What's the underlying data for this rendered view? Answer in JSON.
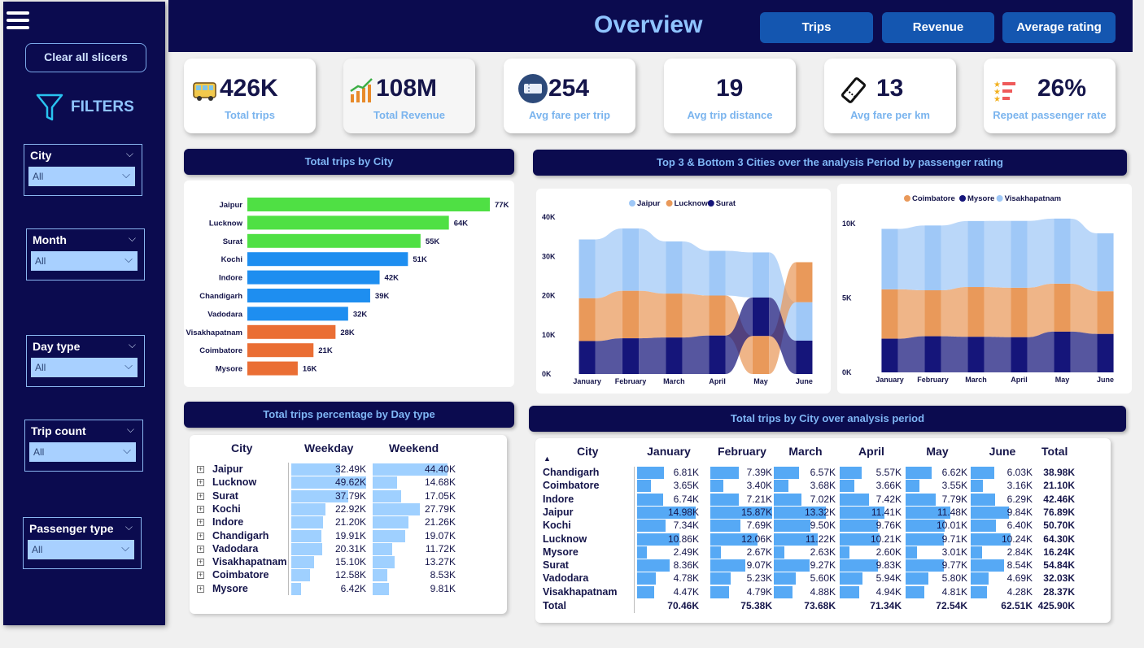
{
  "sidebar": {
    "clear_label": "Clear all slicers",
    "filters_label": "FILTERS",
    "slicers": [
      {
        "label": "City",
        "value": "All"
      },
      {
        "label": "Month",
        "value": "All"
      },
      {
        "label": "Day type",
        "value": "All"
      },
      {
        "label": "Trip count",
        "value": "All"
      },
      {
        "label": "Passenger type",
        "value": "All"
      }
    ]
  },
  "header": {
    "title": "Overview",
    "buttons": [
      "Trips",
      "Revenue",
      "Average rating"
    ]
  },
  "kpis": [
    {
      "value": "426K",
      "label": "Total trips",
      "icon": "bus-icon"
    },
    {
      "value": "108M",
      "label": "Total Revenue",
      "icon": "revenue-chart-icon"
    },
    {
      "value": "254",
      "label": "Avg fare per trip",
      "icon": "ticket-icon"
    },
    {
      "value": "19",
      "label": "Avg trip distance",
      "icon": ""
    },
    {
      "value": "13",
      "label": "Avg fare per km",
      "icon": "ticket-stub-icon"
    },
    {
      "value": "26%",
      "label": "Repeat passenger rate",
      "icon": "star-list-icon"
    }
  ],
  "panels": {
    "trips_by_city": "Total trips by City",
    "top_bottom": "Top 3 & Bottom 3 Cities over the analysis Period by passenger rating",
    "day_type": "Total trips  percentage by Day type",
    "city_period": "Total trips by City over analysis period"
  },
  "colors": {
    "top": "#4fe044",
    "mid": "#1e8ef0",
    "low": "#ea6e34",
    "light": "#9fc8f7",
    "orange": "#e9995a",
    "navy": "#15157a"
  },
  "chart_data": [
    {
      "type": "bar",
      "title": "Total trips by City",
      "categories": [
        "Jaipur",
        "Lucknow",
        "Surat",
        "Kochi",
        "Indore",
        "Chandigarh",
        "Vadodara",
        "Visakhapatnam",
        "Coimbatore",
        "Mysore"
      ],
      "values": [
        77,
        64,
        55,
        51,
        42,
        39,
        32,
        28,
        21,
        16
      ],
      "labels": [
        "77K",
        "64K",
        "55K",
        "51K",
        "42K",
        "39K",
        "32K",
        "28K",
        "21K",
        "16K"
      ],
      "groups": [
        "top",
        "top",
        "top",
        "mid",
        "mid",
        "mid",
        "mid",
        "low",
        "low",
        "low"
      ]
    },
    {
      "type": "area",
      "title": "Top 3",
      "categories": [
        "January",
        "February",
        "March",
        "April",
        "May",
        "June"
      ],
      "series": [
        {
          "name": "Jaipur",
          "values": [
            15.0,
            15.9,
            13.3,
            11.4,
            11.5,
            9.8
          ]
        },
        {
          "name": "Lucknow",
          "values": [
            10.9,
            12.1,
            11.2,
            10.2,
            9.7,
            10.2
          ]
        },
        {
          "name": "Surat",
          "values": [
            8.4,
            9.1,
            9.3,
            9.8,
            9.8,
            8.5
          ]
        }
      ],
      "ytick_labels": [
        "0K",
        "10K",
        "20K",
        "30K",
        "40K"
      ],
      "ylim": [
        0,
        40
      ]
    },
    {
      "type": "area",
      "title": "Bottom 3",
      "categories": [
        "January",
        "February",
        "March",
        "April",
        "May",
        "June"
      ],
      "series": [
        {
          "name": "Coimbatore",
          "values": [
            3.65,
            3.4,
            3.68,
            3.66,
            3.55,
            3.16
          ]
        },
        {
          "name": "Mysore",
          "values": [
            2.49,
            2.67,
            2.63,
            2.6,
            3.01,
            2.84
          ]
        },
        {
          "name": "Visakhapatnam",
          "values": [
            4.47,
            4.79,
            4.88,
            4.94,
            4.81,
            4.28
          ]
        }
      ],
      "ytick_labels": [
        "0K",
        "5K",
        "10K"
      ],
      "ylim": [
        0,
        11
      ]
    }
  ],
  "day_type_table": {
    "headers": [
      "City",
      "Weekday",
      "Weekend"
    ],
    "rows": [
      {
        "city": "Jaipur",
        "weekday": "32.49K",
        "weekend": "44.40K",
        "wd": 32.49,
        "we": 44.4
      },
      {
        "city": "Lucknow",
        "weekday": "49.62K",
        "weekend": "14.68K",
        "wd": 49.62,
        "we": 14.68
      },
      {
        "city": "Surat",
        "weekday": "37.79K",
        "weekend": "17.05K",
        "wd": 37.79,
        "we": 17.05
      },
      {
        "city": "Kochi",
        "weekday": "22.92K",
        "weekend": "27.79K",
        "wd": 22.92,
        "we": 27.79
      },
      {
        "city": "Indore",
        "weekday": "21.20K",
        "weekend": "21.26K",
        "wd": 21.2,
        "we": 21.26
      },
      {
        "city": "Chandigarh",
        "weekday": "19.91K",
        "weekend": "19.07K",
        "wd": 19.91,
        "we": 19.07
      },
      {
        "city": "Vadodara",
        "weekday": "20.31K",
        "weekend": "11.72K",
        "wd": 20.31,
        "we": 11.72
      },
      {
        "city": "Visakhapatnam",
        "weekday": "15.10K",
        "weekend": "13.27K",
        "wd": 15.1,
        "we": 13.27
      },
      {
        "city": "Coimbatore",
        "weekday": "12.58K",
        "weekend": "8.53K",
        "wd": 12.58,
        "we": 8.53
      },
      {
        "city": "Mysore",
        "weekday": "6.42K",
        "weekend": "9.81K",
        "wd": 6.42,
        "we": 9.81
      }
    ]
  },
  "period_table": {
    "headers": [
      "City",
      "January",
      "February",
      "March",
      "April",
      "May",
      "June",
      "Total"
    ],
    "rows": [
      {
        "city": "Chandigarh",
        "cells": [
          "6.81K",
          "7.39K",
          "6.57K",
          "5.57K",
          "6.62K",
          "6.03K"
        ],
        "nums": [
          6.81,
          7.39,
          6.57,
          5.57,
          6.62,
          6.03
        ],
        "total": "38.98K"
      },
      {
        "city": "Coimbatore",
        "cells": [
          "3.65K",
          "3.40K",
          "3.68K",
          "3.66K",
          "3.55K",
          "3.16K"
        ],
        "nums": [
          3.65,
          3.4,
          3.68,
          3.66,
          3.55,
          3.16
        ],
        "total": "21.10K"
      },
      {
        "city": "Indore",
        "cells": [
          "6.74K",
          "7.21K",
          "7.02K",
          "7.42K",
          "7.79K",
          "6.29K"
        ],
        "nums": [
          6.74,
          7.21,
          7.02,
          7.42,
          7.79,
          6.29
        ],
        "total": "42.46K"
      },
      {
        "city": "Jaipur",
        "cells": [
          "14.98K",
          "15.87K",
          "13.32K",
          "11.41K",
          "11.48K",
          "9.84K"
        ],
        "nums": [
          14.98,
          15.87,
          13.32,
          11.41,
          11.48,
          9.84
        ],
        "total": "76.89K"
      },
      {
        "city": "Kochi",
        "cells": [
          "7.34K",
          "7.69K",
          "9.50K",
          "9.76K",
          "10.01K",
          "6.40K"
        ],
        "nums": [
          7.34,
          7.69,
          9.5,
          9.76,
          10.01,
          6.4
        ],
        "total": "50.70K"
      },
      {
        "city": "Lucknow",
        "cells": [
          "10.86K",
          "12.06K",
          "11.22K",
          "10.21K",
          "9.71K",
          "10.24K"
        ],
        "nums": [
          10.86,
          12.06,
          11.22,
          10.21,
          9.71,
          10.24
        ],
        "total": "64.30K"
      },
      {
        "city": "Mysore",
        "cells": [
          "2.49K",
          "2.67K",
          "2.63K",
          "2.60K",
          "3.01K",
          "2.84K"
        ],
        "nums": [
          2.49,
          2.67,
          2.63,
          2.6,
          3.01,
          2.84
        ],
        "total": "16.24K"
      },
      {
        "city": "Surat",
        "cells": [
          "8.36K",
          "9.07K",
          "9.27K",
          "9.83K",
          "9.77K",
          "8.54K"
        ],
        "nums": [
          8.36,
          9.07,
          9.27,
          9.83,
          9.77,
          8.54
        ],
        "total": "54.84K"
      },
      {
        "city": "Vadodara",
        "cells": [
          "4.78K",
          "5.23K",
          "5.60K",
          "5.94K",
          "5.80K",
          "4.69K"
        ],
        "nums": [
          4.78,
          5.23,
          5.6,
          5.94,
          5.8,
          4.69
        ],
        "total": "32.03K"
      },
      {
        "city": "Visakhapatnam",
        "cells": [
          "4.47K",
          "4.79K",
          "4.88K",
          "4.94K",
          "4.81K",
          "4.28K"
        ],
        "nums": [
          4.47,
          4.79,
          4.88,
          4.94,
          4.81,
          4.28
        ],
        "total": "28.37K"
      }
    ],
    "total_row": {
      "label": "Total",
      "cells": [
        "70.46K",
        "75.38K",
        "73.68K",
        "71.34K",
        "72.54K",
        "62.51K"
      ],
      "total": "425.90K"
    }
  }
}
